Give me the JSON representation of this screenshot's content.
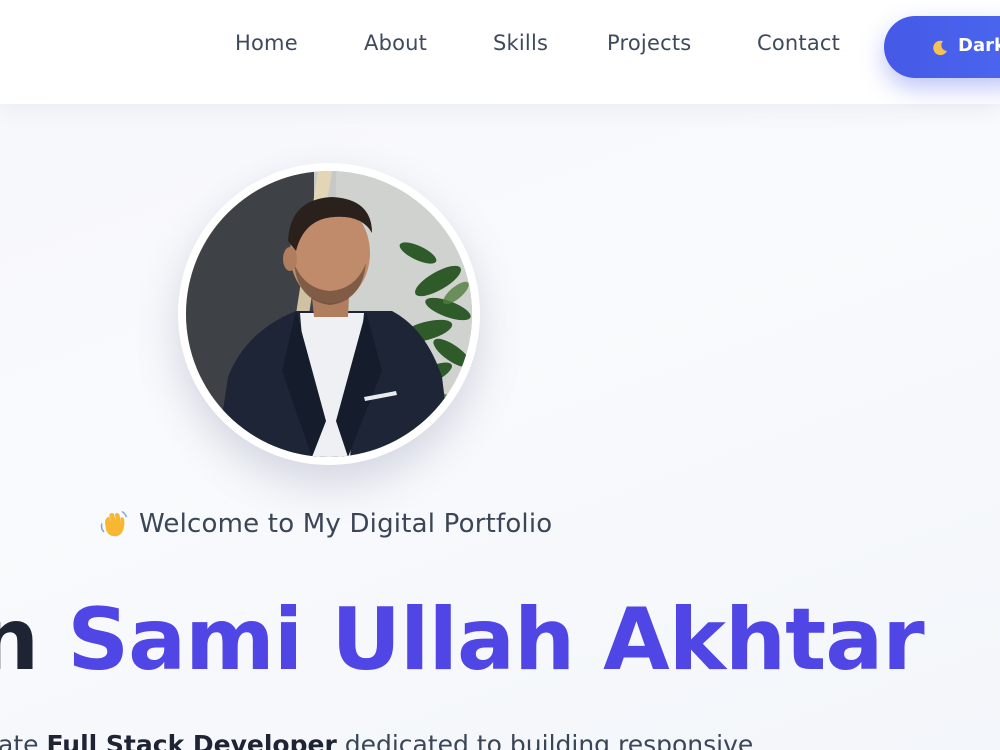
{
  "nav": {
    "items": [
      {
        "label": "Home"
      },
      {
        "label": "About"
      },
      {
        "label": "Skills"
      },
      {
        "label": "Projects"
      },
      {
        "label": "Contact"
      }
    ],
    "theme_toggle": {
      "icon": "crescent-moon-icon",
      "label": "Dark"
    }
  },
  "hero": {
    "avatar_alt": "Portrait photo",
    "welcome": {
      "icon": "waving-hand-icon",
      "text": "Welcome to My Digital Portfolio"
    },
    "title_prefix": "n",
    "name": "Sami Ullah Akhtar",
    "subtitle": {
      "prefix": "ate ",
      "role": "Full Stack Developer",
      "suffix": " dedicated to building responsive"
    }
  },
  "colors": {
    "accent": "#4f46e5",
    "button_gradient_start": "#4559e6",
    "button_gradient_end": "#4b68f0",
    "nav_text": "#3e4a5c",
    "heading_dark": "#1e2433",
    "background": "#f6f7fc"
  }
}
